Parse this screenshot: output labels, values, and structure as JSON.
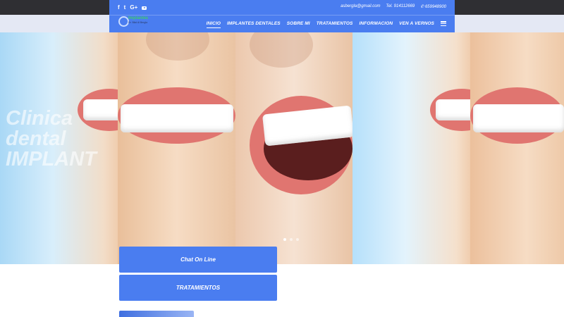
{
  "social": {
    "facebook": "f",
    "twitter": "t",
    "google_plus": "G+",
    "youtube_icon": "youtube-icon"
  },
  "contact": {
    "email": "asbergla@gmail.com",
    "phone": "Tel. 914112669",
    "mobile": "✆ 659948900"
  },
  "logo": {
    "name": "Implantes",
    "subtitle": "Dr. Bilal Al Bergla"
  },
  "nav": {
    "items": [
      {
        "label": "INICIO",
        "active": true
      },
      {
        "label": "IMPLANTES DENTALES"
      },
      {
        "label": "SOBRE MI"
      },
      {
        "label": "TRATAMIENTOS"
      },
      {
        "label": "INFORMACION"
      },
      {
        "label": "VEN A VERNOS"
      }
    ]
  },
  "hero": {
    "line1": "Clinica",
    "line2": "dental",
    "line3": "IMPLANT",
    "slide_count": 3,
    "active_slide": 1
  },
  "buttons": {
    "chat": "Chat On Line",
    "tratamientos": "TRATAMIENTOS"
  },
  "colors": {
    "accent": "#4a7df0",
    "topbar": "#2f2f33"
  }
}
